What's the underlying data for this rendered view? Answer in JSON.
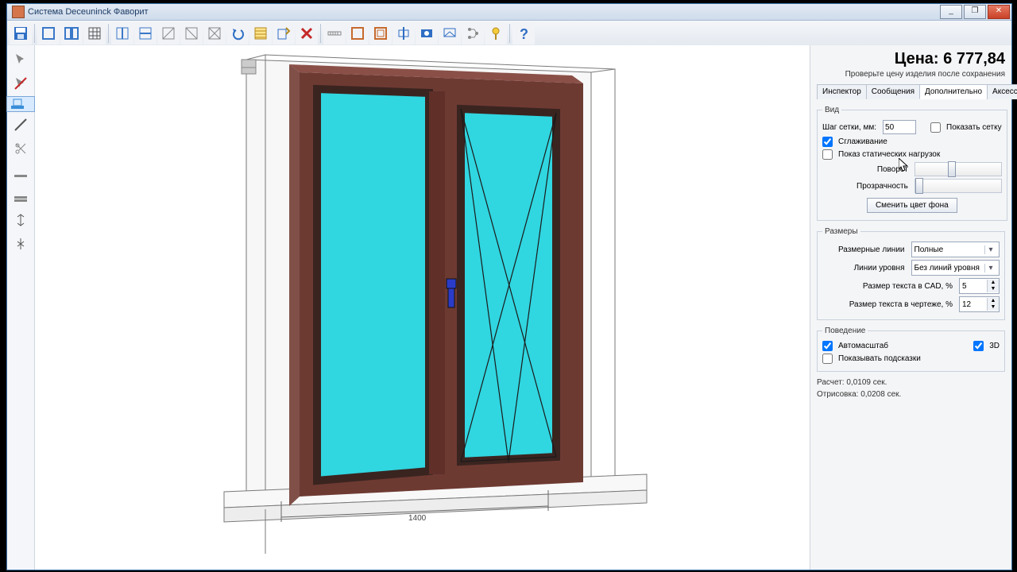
{
  "title": "Система Deceuninck Фаворит",
  "winbtns": {
    "min": "_",
    "max": "❐",
    "close": "✕"
  },
  "price_label": "Цена: ",
  "price_value": "6 777,84",
  "price_hint": "Проверьте цену изделия после сохранения",
  "tabs": [
    "Инспектор",
    "Сообщения",
    "Дополнительно",
    "Аксессуары"
  ],
  "view": {
    "legend": "Вид",
    "grid_step_label": "Шаг сетки, мм:",
    "grid_step_value": "50",
    "show_grid": "Показать сетку",
    "smoothing": "Сглаживание",
    "static_loads": "Показ статических нагрузок",
    "rotation": "Поворот",
    "transparency": "Прозрачность",
    "change_bg": "Сменить цвет фона"
  },
  "sizes": {
    "legend": "Размеры",
    "dimlines_label": "Размерные линии",
    "dimlines_value": "Полные",
    "level_label": "Линии уровня",
    "level_value": "Без линий уровня",
    "cad_label": "Размер текста в CAD, %",
    "cad_value": "5",
    "draw_label": "Размер текста в чертеже, %",
    "draw_value": "12"
  },
  "behavior": {
    "legend": "Поведение",
    "autoscale": "Автомасштаб",
    "three_d": "3D",
    "tooltips": "Показывать подсказки"
  },
  "stats": {
    "calc": "Расчет: 0,0109 сек.",
    "render": "Отрисовка: 0,0208 сек."
  },
  "canvas_dim": "1400"
}
